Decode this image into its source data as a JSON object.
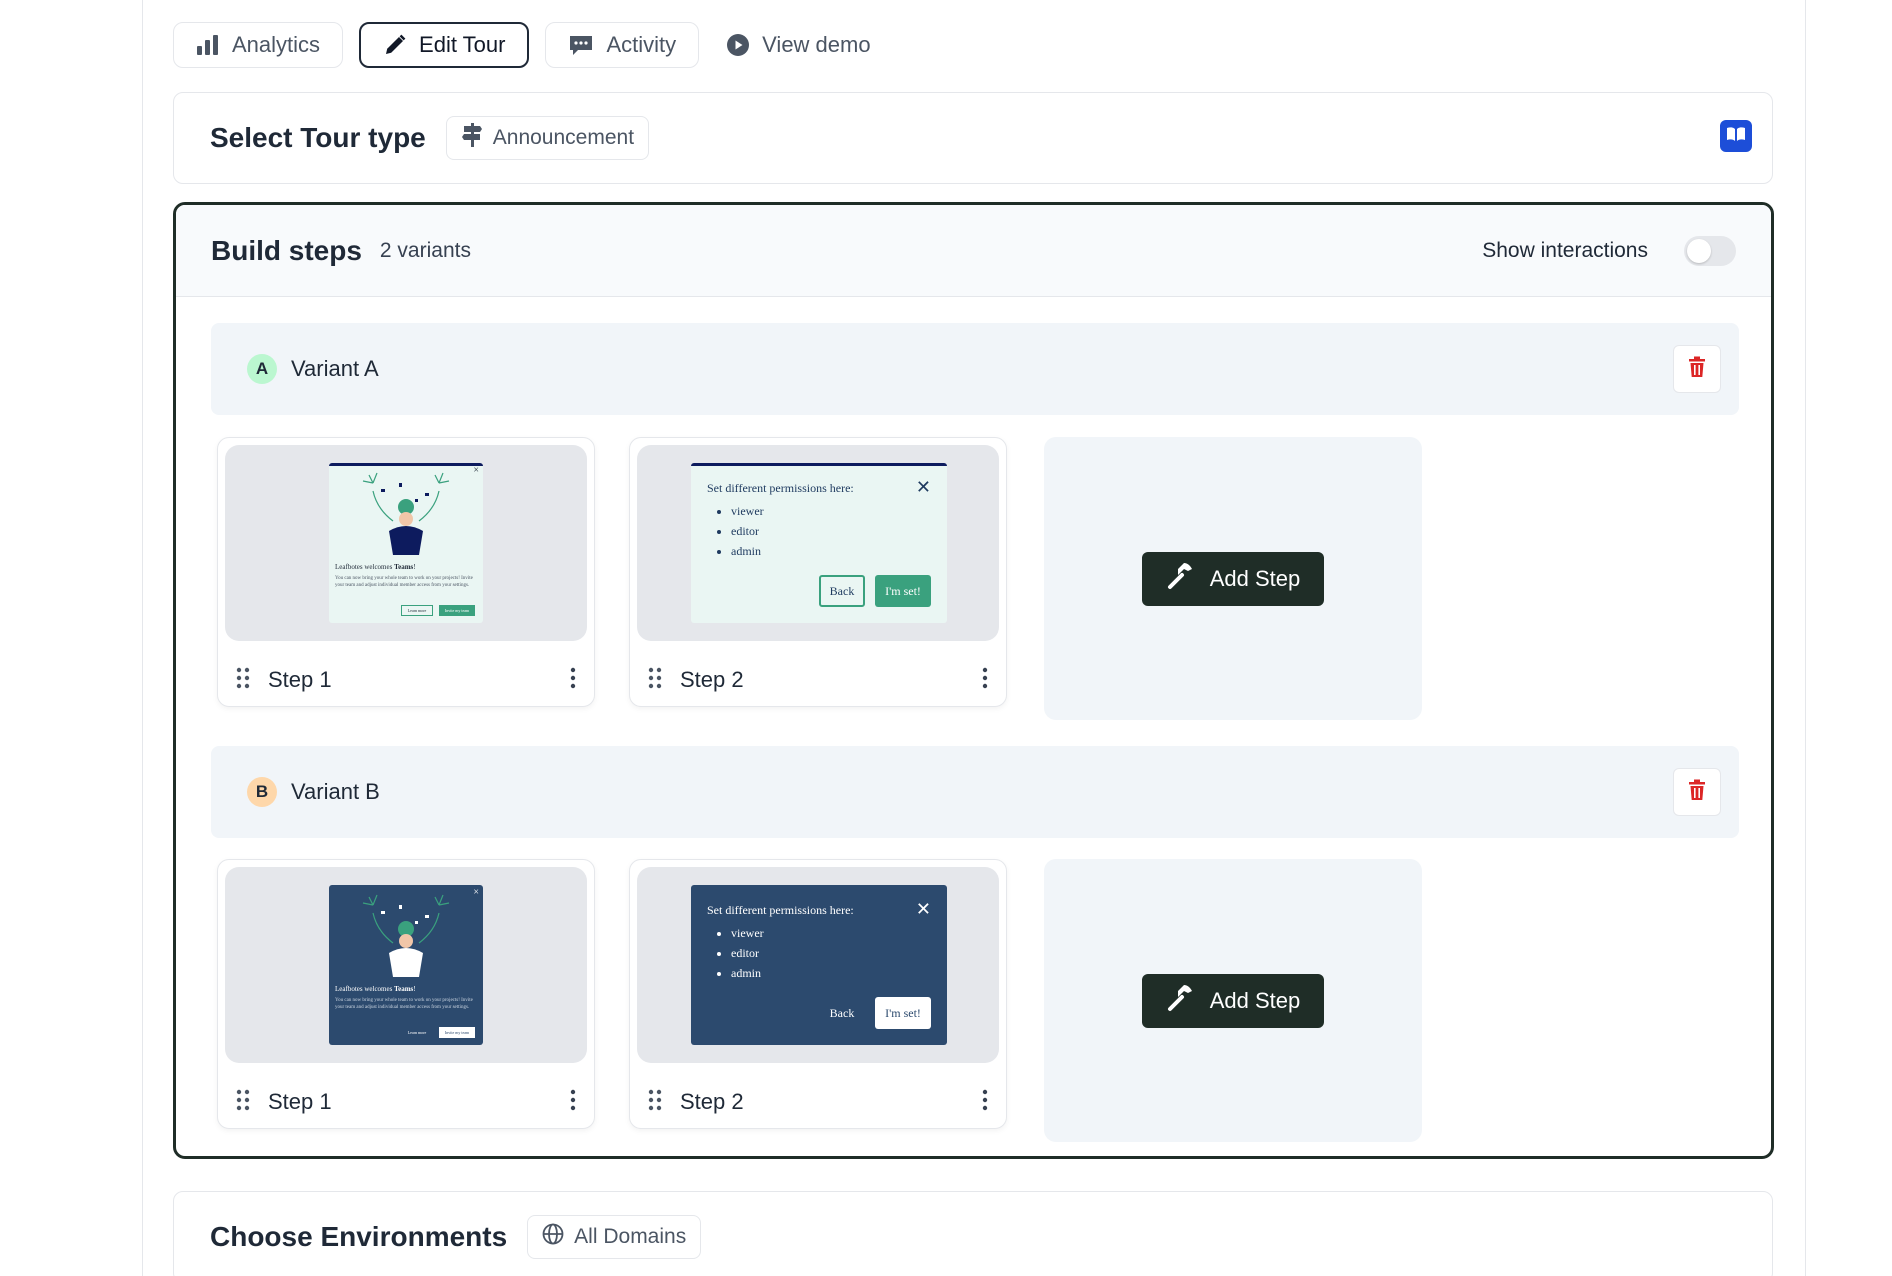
{
  "tabs": [
    {
      "label": "Analytics",
      "icon": "bar-chart-icon"
    },
    {
      "label": "Edit Tour",
      "icon": "pencil-icon",
      "active": true
    },
    {
      "label": "Activity",
      "icon": "chat-icon"
    },
    {
      "label": "View demo",
      "icon": "play-circle-icon"
    }
  ],
  "tour_type": {
    "title": "Select Tour type",
    "value": "Announcement",
    "icon": "signpost-icon",
    "help_icon": "book-icon"
  },
  "build": {
    "title": "Build steps",
    "variant_count": "2 variants",
    "toggle_label": "Show interactions",
    "toggle_on": false
  },
  "variants": [
    {
      "badge": "A",
      "name": "Variant A",
      "steps": [
        {
          "label": "Step 1",
          "preview": {
            "close": "×",
            "caption_pre": "Leafbotes welcomes ",
            "caption_bold": "Teams",
            "caption_post": "!",
            "desc": "You can now bring your whole team to work on your projects! Invite your team and adjust individual member access from your settings.",
            "btn_secondary": "Learn more",
            "btn_primary": "Invite my team"
          }
        },
        {
          "label": "Step 2",
          "preview": {
            "title": "Set different permissions here:",
            "items": [
              "viewer",
              "editor",
              "admin"
            ],
            "back": "Back",
            "primary": "I'm set!",
            "close": "✕"
          }
        }
      ],
      "add_step": "Add Step"
    },
    {
      "badge": "B",
      "name": "Variant B",
      "steps": [
        {
          "label": "Step 1",
          "preview": {
            "close": "×",
            "caption_pre": "Leafbotes welcomes ",
            "caption_bold": "Teams",
            "caption_post": "!",
            "desc": "You can now bring your whole team to work on your projects! Invite your team and adjust individual member access from your settings.",
            "btn_secondary": "Learn more",
            "btn_primary": "Invite my team"
          }
        },
        {
          "label": "Step 2",
          "preview": {
            "title": "Set different permissions here:",
            "items": [
              "viewer",
              "editor",
              "admin"
            ],
            "back": "Back",
            "primary": "I'm set!",
            "close": "✕"
          }
        }
      ],
      "add_step": "Add Step"
    }
  ],
  "environments": {
    "title": "Choose Environments",
    "value": "All Domains",
    "icon": "globe-icon"
  },
  "colors": {
    "primary_dark": "#1f2d27",
    "danger": "#dc2626",
    "badge_a": "#bbf7d0",
    "badge_b": "#fed7aa",
    "accent_blue": "#1d4ed8",
    "preview_green": "#3aa17e",
    "preview_dark": "#2c4a6e"
  }
}
